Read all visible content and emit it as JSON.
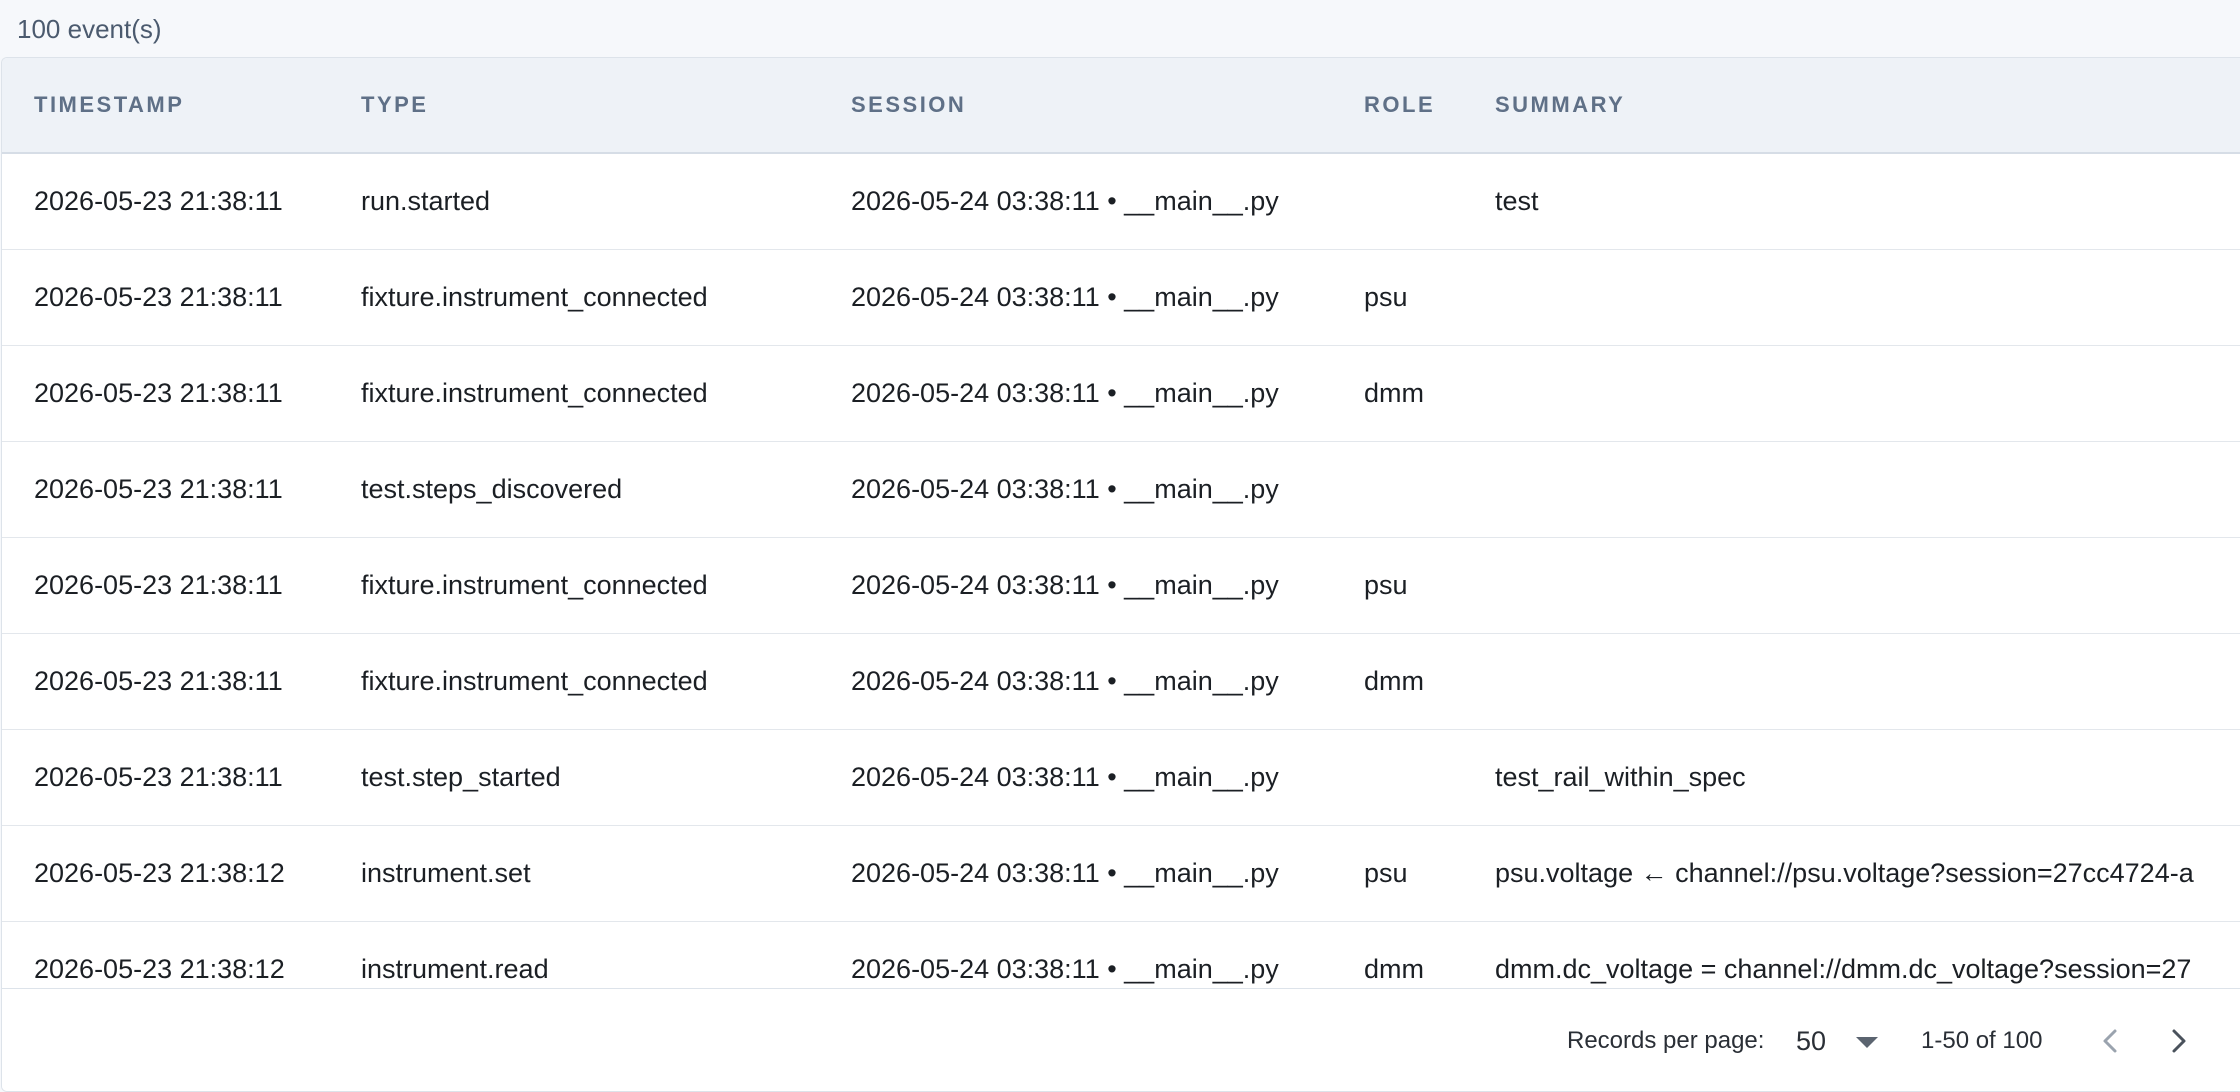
{
  "event_count": "100 event(s)",
  "table": {
    "columns": {
      "timestamp": "TIMESTAMP",
      "type": "TYPE",
      "session": "SESSION",
      "role": "ROLE",
      "summary": "SUMMARY"
    },
    "rows": [
      {
        "timestamp": "2026-05-23 21:38:11",
        "type": "run.started",
        "session": "2026-05-24 03:38:11 • __main__.py",
        "role": "",
        "summary": "test"
      },
      {
        "timestamp": "2026-05-23 21:38:11",
        "type": "fixture.instrument_connected",
        "session": "2026-05-24 03:38:11 • __main__.py",
        "role": "psu",
        "summary": ""
      },
      {
        "timestamp": "2026-05-23 21:38:11",
        "type": "fixture.instrument_connected",
        "session": "2026-05-24 03:38:11 • __main__.py",
        "role": "dmm",
        "summary": ""
      },
      {
        "timestamp": "2026-05-23 21:38:11",
        "type": "test.steps_discovered",
        "session": "2026-05-24 03:38:11 • __main__.py",
        "role": "",
        "summary": ""
      },
      {
        "timestamp": "2026-05-23 21:38:11",
        "type": "fixture.instrument_connected",
        "session": "2026-05-24 03:38:11 • __main__.py",
        "role": "psu",
        "summary": ""
      },
      {
        "timestamp": "2026-05-23 21:38:11",
        "type": "fixture.instrument_connected",
        "session": "2026-05-24 03:38:11 • __main__.py",
        "role": "dmm",
        "summary": ""
      },
      {
        "timestamp": "2026-05-23 21:38:11",
        "type": "test.step_started",
        "session": "2026-05-24 03:38:11 • __main__.py",
        "role": "",
        "summary": "test_rail_within_spec"
      },
      {
        "timestamp": "2026-05-23 21:38:12",
        "type": "instrument.set",
        "session": "2026-05-24 03:38:11 • __main__.py",
        "role": "psu",
        "summary": "psu.voltage ← channel://psu.voltage?session=27cc4724-a"
      },
      {
        "timestamp": "2026-05-23 21:38:12",
        "type": "instrument.read",
        "session": "2026-05-24 03:38:11 • __main__.py",
        "role": "dmm",
        "summary": "dmm.dc_voltage = channel://dmm.dc_voltage?session=27"
      }
    ]
  },
  "footer": {
    "rows_per_page_label": "Records per page:",
    "rows_per_page_value": "50",
    "range": "1-50 of 100",
    "prev_icon": "chevron-left-icon",
    "next_icon": "chevron-right-icon"
  }
}
